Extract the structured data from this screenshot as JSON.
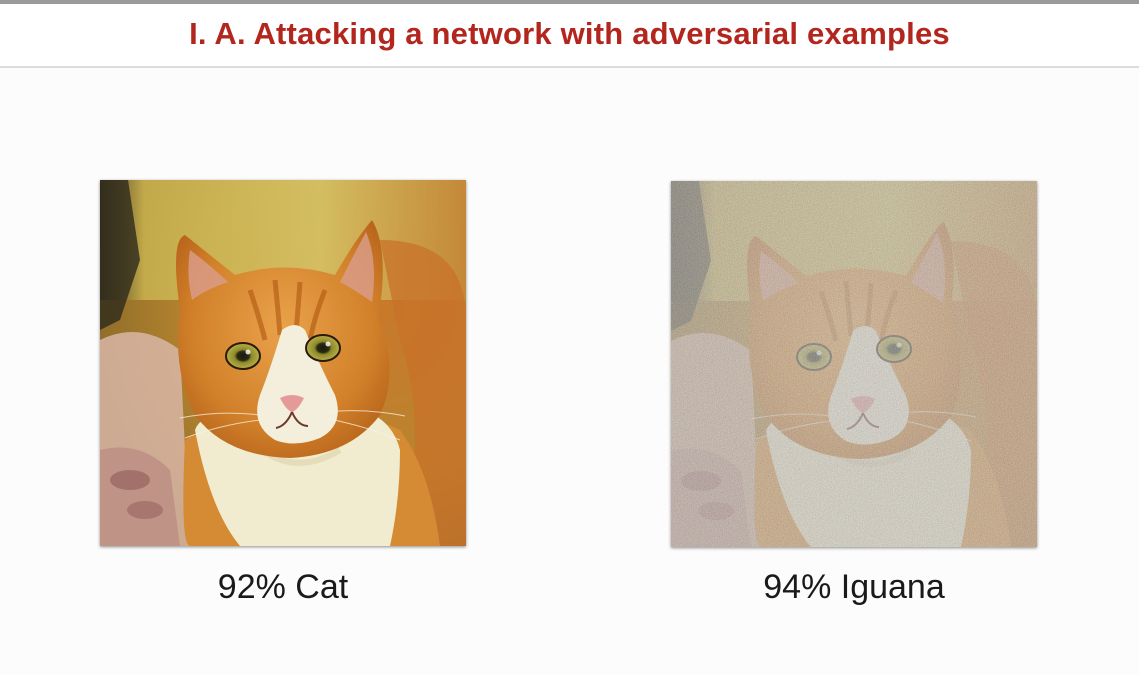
{
  "slide": {
    "title": "I. A. Attacking a network with adversarial examples"
  },
  "examples": [
    {
      "caption": "92% Cat",
      "image": "cat-photo-original"
    },
    {
      "caption": "94% Iguana",
      "image": "cat-photo-adversarial-noise"
    }
  ],
  "colors": {
    "title": "#b3261e",
    "caption": "#1a1a1a",
    "background": "#fcfcfc"
  }
}
